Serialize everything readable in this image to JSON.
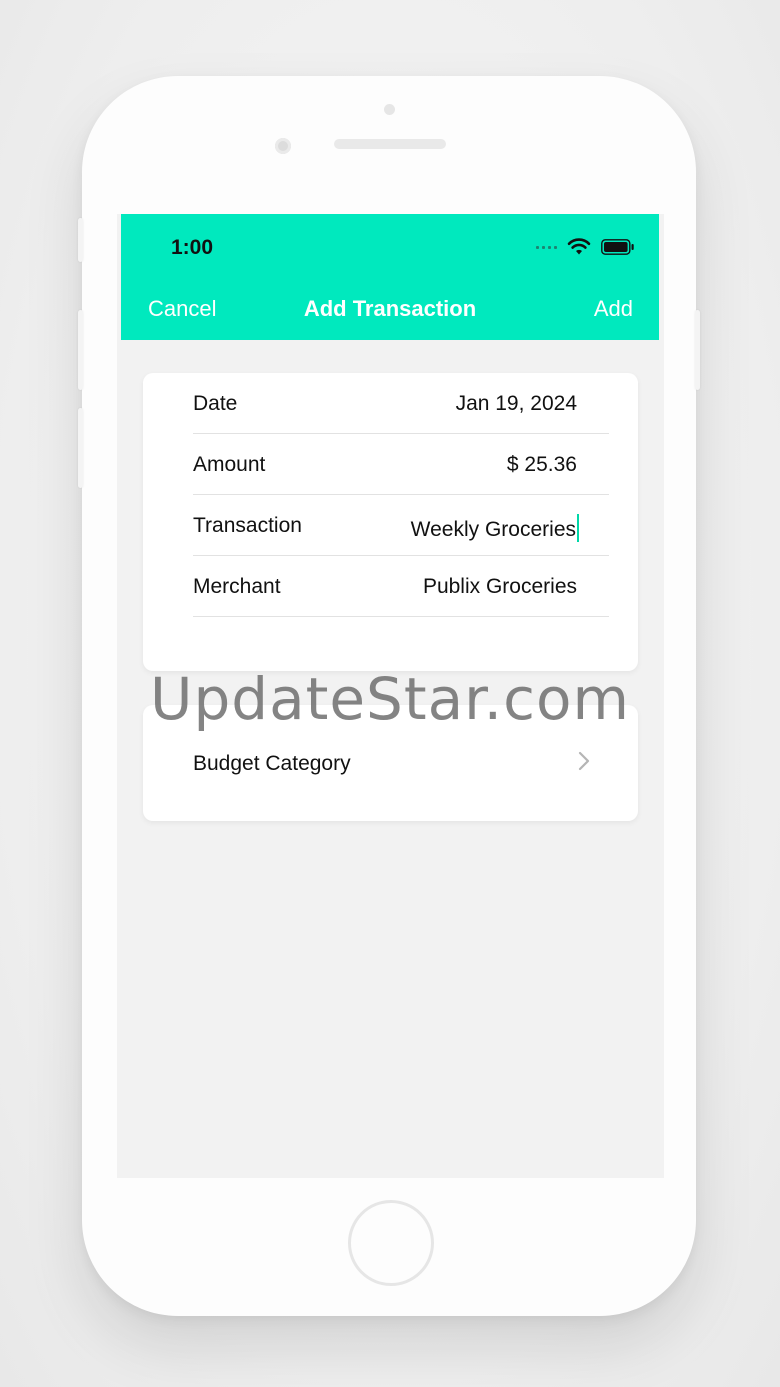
{
  "status_bar": {
    "time": "1:00"
  },
  "nav": {
    "cancel_label": "Cancel",
    "title": "Add Transaction",
    "add_label": "Add"
  },
  "form": {
    "rows": [
      {
        "label": "Date",
        "value": "Jan 19, 2024"
      },
      {
        "label": "Amount",
        "value": "$ 25.36"
      },
      {
        "label": "Transaction",
        "value": "Weekly Groceries"
      },
      {
        "label": "Merchant",
        "value": "Publix Groceries"
      }
    ]
  },
  "budget": {
    "label": "Budget Category"
  },
  "watermark": "UpdateStar.com",
  "colors": {
    "accent": "#00e9be",
    "caret": "#00d7a8"
  }
}
